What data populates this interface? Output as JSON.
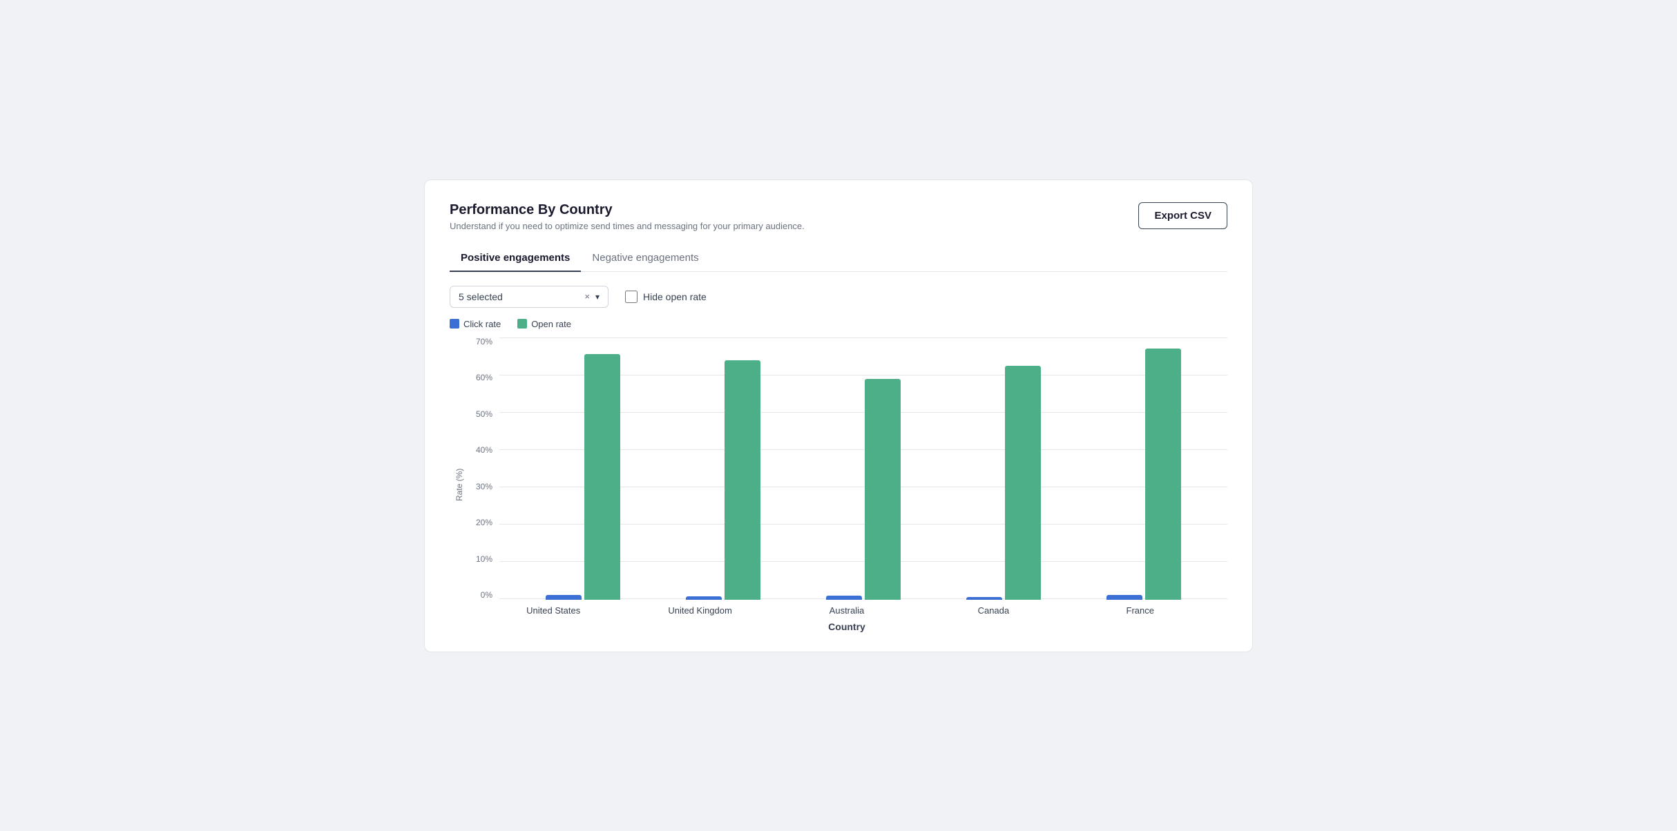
{
  "card": {
    "title": "Performance By Country",
    "subtitle": "Understand if you need to optimize send times and messaging for your primary audience."
  },
  "export_button": "Export CSV",
  "tabs": [
    {
      "label": "Positive engagements",
      "active": true
    },
    {
      "label": "Negative engagements",
      "active": false
    }
  ],
  "controls": {
    "dropdown": {
      "selected_text": "5 selected",
      "clear_label": "×"
    },
    "hide_open_rate_label": "Hide open rate"
  },
  "legend": [
    {
      "key": "click",
      "label": "Click rate",
      "color": "#3b6fd4"
    },
    {
      "key": "open",
      "label": "Open rate",
      "color": "#4caf88"
    }
  ],
  "y_axis": {
    "label": "Rate (%)",
    "ticks": [
      "0%",
      "10%",
      "20%",
      "30%",
      "40%",
      "50%",
      "60%",
      "70%"
    ]
  },
  "x_axis": {
    "title": "Country"
  },
  "chart_data": [
    {
      "country": "United States",
      "click_rate": 1.2,
      "open_rate": 65.5
    },
    {
      "country": "United Kingdom",
      "click_rate": 0.9,
      "open_rate": 64.0
    },
    {
      "country": "Australia",
      "click_rate": 1.1,
      "open_rate": 59.0
    },
    {
      "country": "Canada",
      "click_rate": 0.8,
      "open_rate": 62.5
    },
    {
      "country": "France",
      "click_rate": 1.3,
      "open_rate": 67.0
    }
  ],
  "chart_max": 70
}
